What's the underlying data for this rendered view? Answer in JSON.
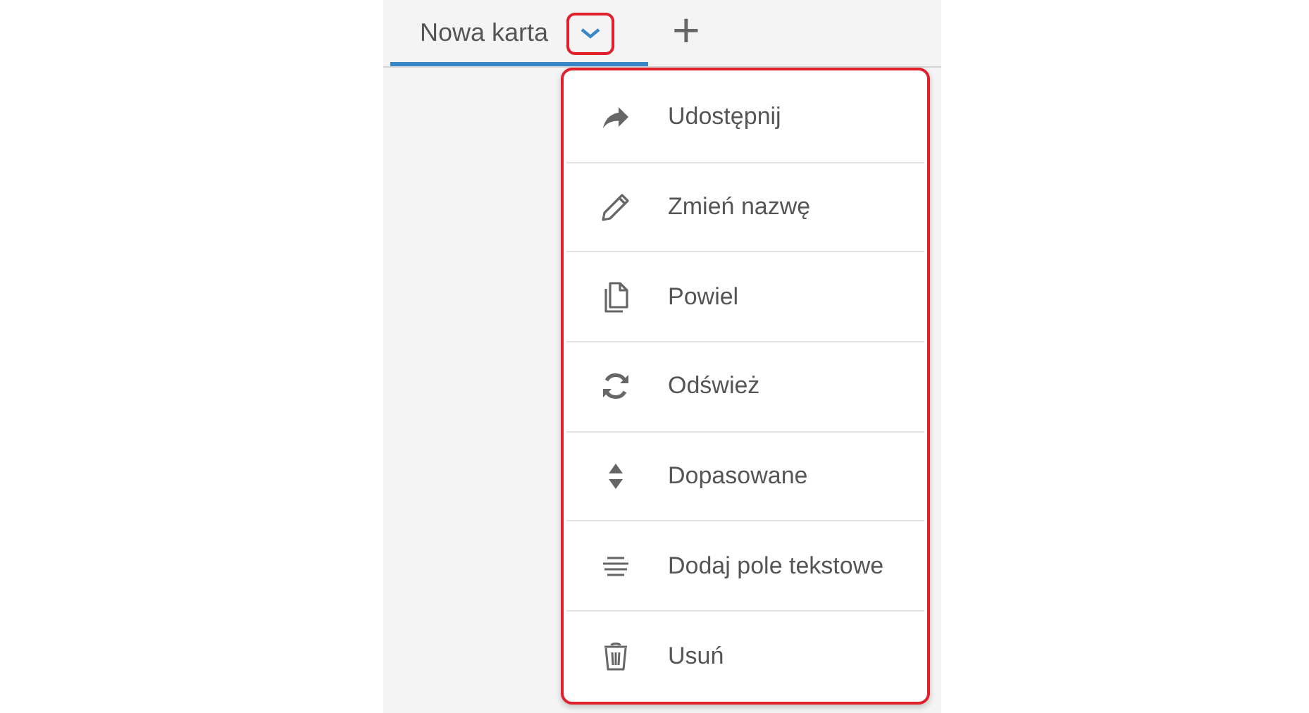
{
  "tabs": [
    {
      "label": "Nowa karta",
      "selected": true,
      "menu_button_highlighted": true
    }
  ],
  "add_tab": "+",
  "tab_menu": {
    "highlighted": true,
    "items": [
      {
        "kind": "share",
        "label": "Udostępnij"
      },
      {
        "kind": "rename",
        "label": "Zmień nazwę"
      },
      {
        "kind": "duplicate",
        "label": "Powiel"
      },
      {
        "kind": "refresh",
        "label": "Odśwież"
      },
      {
        "kind": "fit",
        "label": "Dopasowane"
      },
      {
        "kind": "textbox",
        "label": "Dodaj pole tekstowe"
      },
      {
        "kind": "delete",
        "label": "Usuń"
      }
    ]
  }
}
